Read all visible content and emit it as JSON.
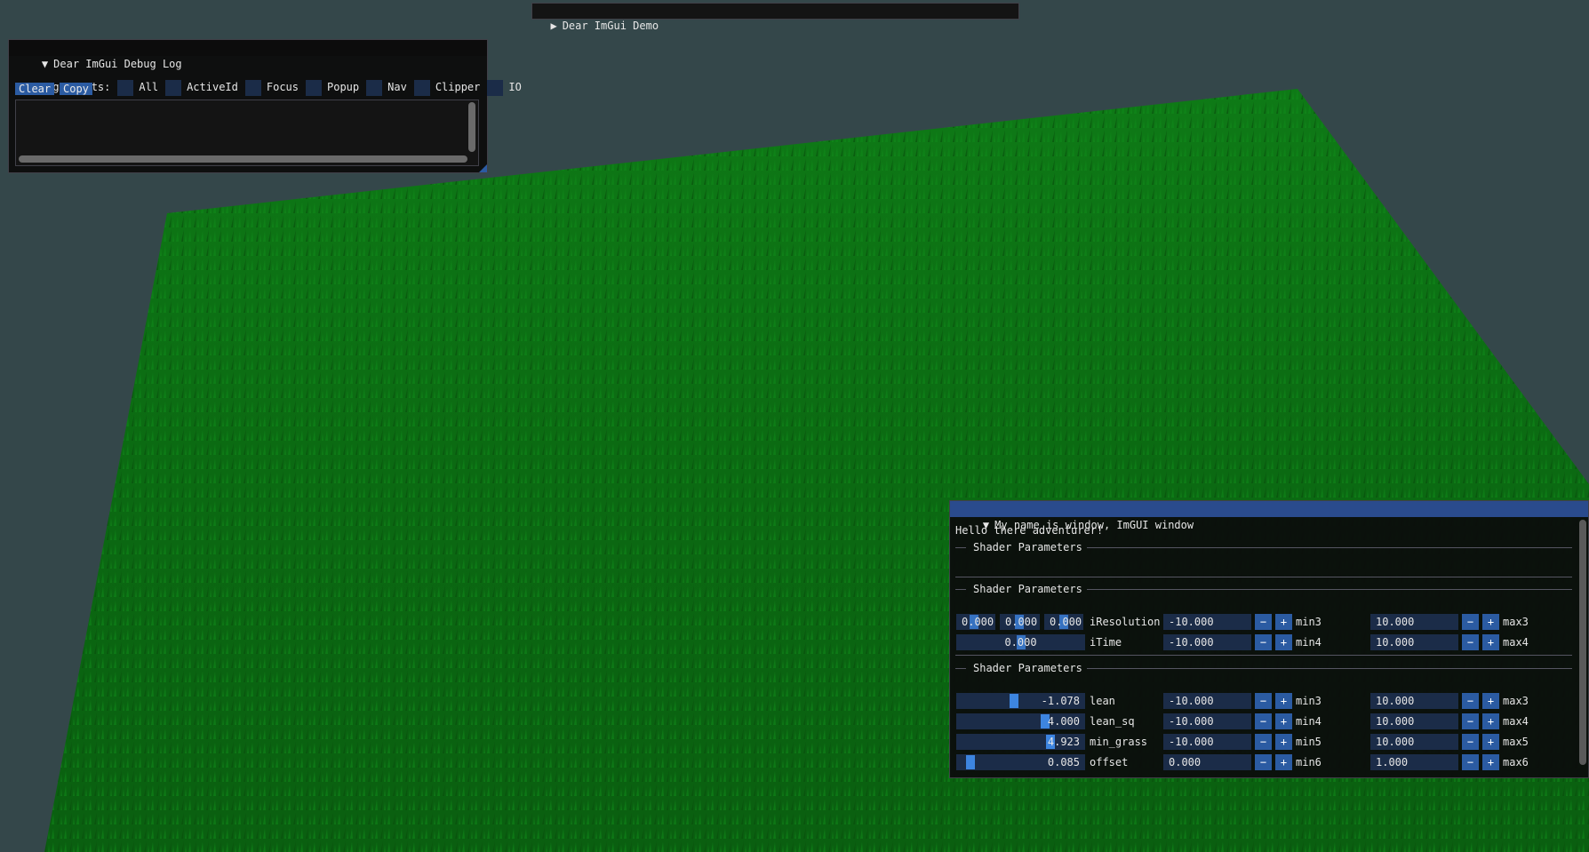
{
  "demo_window": {
    "title": "Dear ImGui Demo"
  },
  "debug_log": {
    "title": "Dear ImGui Debug Log",
    "log_events_label": "Log events:",
    "checkboxes": [
      "All",
      "ActiveId",
      "Focus",
      "Popup",
      "Nav",
      "Clipper",
      "IO"
    ],
    "clear_label": "Clear",
    "copy_label": "Copy"
  },
  "shader_window": {
    "title": "My name is window, ImGUI window",
    "greeting": "Hello there adventurer!",
    "section_labels": [
      "Shader Parameters",
      "Shader Parameters",
      "Shader Parameters"
    ],
    "iresolution": {
      "values": [
        "0.000",
        "0.000",
        "0.000"
      ],
      "label": "iResolution",
      "min": "-10.000",
      "min_label": "min3",
      "max": "10.000",
      "max_label": "max3"
    },
    "itime": {
      "value": "0.000",
      "label": "iTime",
      "min": "-10.000",
      "min_label": "min4",
      "max": "10.000",
      "max_label": "max4"
    },
    "params": [
      {
        "value": "-1.078",
        "label": "lean",
        "min": "-10.000",
        "min_label": "min3",
        "max": "10.000",
        "max_label": "max3",
        "slider_fraction": 0.446
      },
      {
        "value": "4.000",
        "label": "lean_sq",
        "min": "-10.000",
        "min_label": "min4",
        "max": "10.000",
        "max_label": "max4",
        "slider_fraction": 0.7
      },
      {
        "value": "4.923",
        "label": "min_grass",
        "min": "-10.000",
        "min_label": "min5",
        "max": "10.000",
        "max_label": "max5",
        "slider_fraction": 0.746
      },
      {
        "value": "0.085",
        "label": "offset",
        "min": "0.000",
        "min_label": "min6",
        "max": "1.000",
        "max_label": "max6",
        "slider_fraction": 0.085
      }
    ],
    "minus_symbol": "−",
    "plus_symbol": "+"
  },
  "colors": {
    "background": "#34474a",
    "grass": "#0b6a12",
    "accent": "#2b5ba2",
    "frame": "#1b2c48",
    "title_active": "#2a4b8d"
  }
}
